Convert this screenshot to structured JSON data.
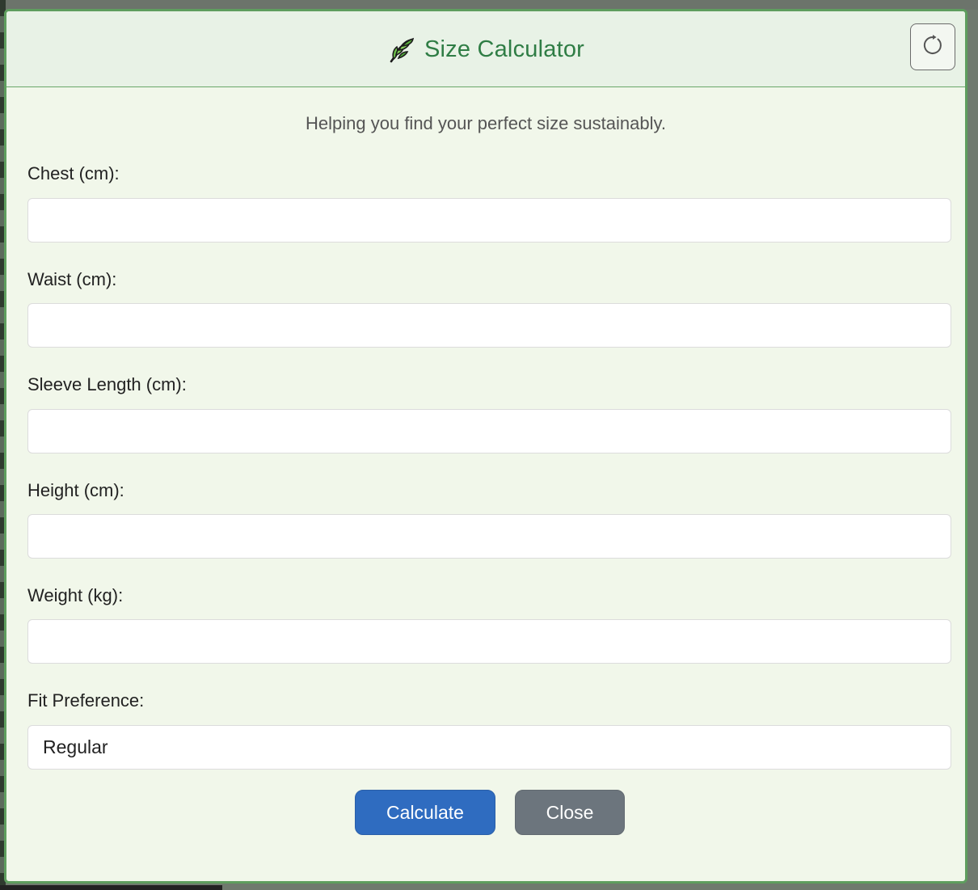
{
  "dialog": {
    "title": "Size Calculator",
    "subtitle": "Helping you find your perfect size sustainably.",
    "icons": {
      "title_icon": "leaf-icon",
      "reset_icon": "refresh-icon"
    },
    "fields": [
      {
        "label": "Chest (cm):",
        "value": ""
      },
      {
        "label": "Waist (cm):",
        "value": ""
      },
      {
        "label": "Sleeve Length (cm):",
        "value": ""
      },
      {
        "label": "Height (cm):",
        "value": ""
      },
      {
        "label": "Weight (kg):",
        "value": ""
      }
    ],
    "fit": {
      "label": "Fit Preference:",
      "selected": "Regular"
    },
    "buttons": {
      "calculate": "Calculate",
      "close": "Close"
    }
  },
  "colors": {
    "accent_green": "#2f7d45",
    "primary_button": "#2f6cc0",
    "secondary_button": "#6c757d",
    "dialog_background": "#f1f7ea"
  }
}
